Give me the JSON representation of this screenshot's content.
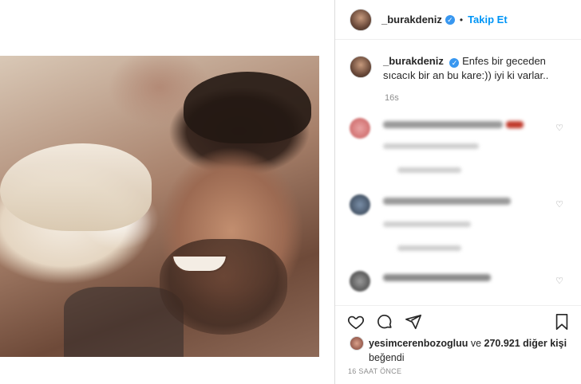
{
  "post": {
    "username": "_burakdeniz",
    "follow_label": "Takip Et",
    "separator": "•",
    "caption": {
      "username": "_burakdeniz",
      "text": "Enfes bir geceden sıcacık bir an bu kare:)) iyi ki varlar.."
    },
    "caption_time": "16s",
    "likes": {
      "liker": "yesimcerenbozogluu",
      "middle": " ve ",
      "count": "270.921 diğer kişi",
      "suffix": "beğendi"
    },
    "date": "16 SAAT ÖNCE"
  },
  "icons": {
    "verified": "verified-badge-icon",
    "like": "heart-icon",
    "comment": "comment-icon",
    "share": "share-icon",
    "save": "bookmark-icon"
  },
  "colors": {
    "accent": "#0095f6",
    "verified": "#3897f0",
    "muted": "#8e8e8e"
  }
}
